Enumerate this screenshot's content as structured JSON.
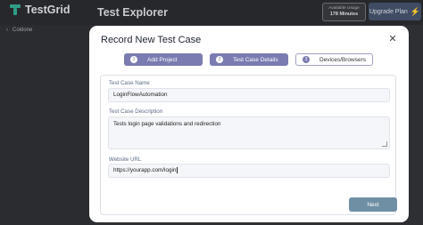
{
  "app": {
    "logo_text": "TestGrid",
    "page_title": "Test Explorer",
    "usage": {
      "label": "Available Usage",
      "value": "178 Minutes"
    },
    "upgrade_label": "Upgrade Plan",
    "breadcrumb": {
      "back_icon": "chevron-left-icon",
      "label": "Coldone"
    }
  },
  "modal": {
    "title": "Record New Test Case",
    "close_icon": "close-icon",
    "steps": [
      {
        "number": "1",
        "label": "Add Project",
        "state": "active"
      },
      {
        "number": "2",
        "label": "Test Case Details",
        "state": "active"
      },
      {
        "number": "3",
        "label": "Devices/Browsers",
        "state": "pending"
      }
    ],
    "fields": {
      "name": {
        "label": "Test Case Name",
        "value": "LoginFlowAutomation"
      },
      "description": {
        "label": "Test Case Description",
        "value": "Tests login page validations and redirection"
      },
      "url": {
        "label": "Website URL",
        "value": "https://yourapp.com/login"
      }
    },
    "next_label": "Next"
  },
  "colors": {
    "accent": "#7a7bb1",
    "brand": "#2f9d86",
    "next_button": "#6f8fa4",
    "upgrade_button": "#3f4c63"
  }
}
